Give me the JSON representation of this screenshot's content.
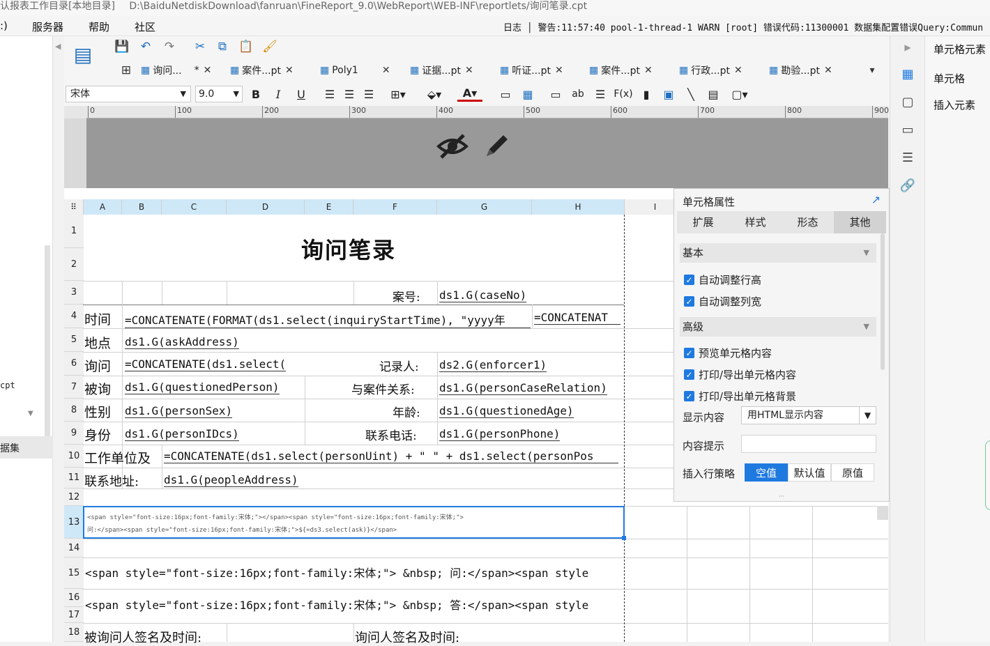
{
  "window": {
    "title_left": "认报表工作目录[本地目录]",
    "title_path": "D:\\BaiduNetdiskDownload\\fanruan\\FineReport_9.0\\WebReport\\WEB-INF\\reportlets/询问笔录.cpt"
  },
  "menubar": {
    "items": [
      ":)",
      "服务器",
      "帮助",
      "社区"
    ],
    "log": "日志 │ 警告:11:57:40 pool-1-thread-1 WARN [root] 错误代码:11300001 数据集配置错误Query:Commun"
  },
  "left_panel": {
    "item_cpt": "cpt",
    "item_dataset": "据集"
  },
  "tabs": [
    {
      "label": "询问...",
      "modified": "*",
      "close": "✕"
    },
    {
      "label": "案件...pt",
      "close": "✕"
    },
    {
      "label": "Poly1",
      "close": "✕"
    },
    {
      "label": "证据...pt",
      "close": "✕"
    },
    {
      "label": "听证...pt",
      "close": "✕"
    },
    {
      "label": "案件...pt",
      "close": "✕"
    },
    {
      "label": "行政...pt",
      "close": "✕"
    },
    {
      "label": "勘验...pt",
      "close": "✕"
    }
  ],
  "format_bar": {
    "font": "宋体",
    "size": "9.0",
    "bold": "B",
    "italic": "I",
    "underline": "U",
    "ab": "ab",
    "fx": "F(x)"
  },
  "ruler": {
    "marks": [
      "0",
      "100",
      "200",
      "300",
      "400",
      "500",
      "600",
      "700",
      "800",
      "900"
    ]
  },
  "sheet": {
    "columns": [
      "A",
      "B",
      "C",
      "D",
      "E",
      "F",
      "G",
      "H",
      "I"
    ],
    "rows": [
      "1",
      "2",
      "3",
      "4",
      "5",
      "6",
      "7",
      "8",
      "9",
      "10",
      "11",
      "12",
      "13",
      "14",
      "15",
      "16",
      "17",
      "18"
    ],
    "title": "询问笔录",
    "cells": {
      "case_no_label": "案号:",
      "case_no": "ds1.G(caseNo)",
      "time_label": "时间",
      "time_formula": "=CONCATENATE(FORMAT(ds1.select(inquiryStartTime), \"yyyy年",
      "time_formula2": "=CONCATENAT",
      "place_label": "地点",
      "place_value": "ds1.G(askAddress)",
      "ask_label": "询问",
      "ask_formula": "=CONCATENATE(ds1.select(",
      "recorder_label": "记录人:",
      "recorder_value": "ds2.G(enforcer1)",
      "questioned_label": "被询",
      "questioned_value": "ds1.G(questionedPerson)",
      "relation_label": "与案件关系:",
      "relation_value": "ds1.G(personCaseRelation)",
      "sex_label": "性别",
      "sex_value": "ds1.G(personSex)",
      "age_label": "年龄:",
      "age_value": "ds1.G(questionedAge)",
      "id_label": "身份",
      "id_value": "ds1.G(personIDcs)",
      "phone_label": "联系电话:",
      "phone_value": "ds1.G(personPhone)",
      "work_label": "工作单位及",
      "work_formula": "=CONCATENATE(ds1.select(personUint) + \"  \" + ds1.select(personPos",
      "address_label": "联系地址:",
      "address_value": "ds1.G(peopleAddress)",
      "row13_line1": "<span style=\"font-size:16px;font-family:宋体;\"></span><span style=\"font-size:16px;font-family:宋体;\">",
      "row13_line2": "问:</span><span style=\"font-size:16px;font-family:宋体;\">${=ds3.select(ask)}</span>",
      "row15": "<span style=\"font-size:16px;font-family:宋体;\"> &nbsp; 问:</span><span style",
      "row16": "<span style=\"font-size:16px;font-family:宋体;\"> &nbsp; 答:</span><span style",
      "row18_left": "被询问人签名及时间:",
      "row18_right": "询问人签名及时间:"
    }
  },
  "properties": {
    "title": "单元格属性",
    "tabs": [
      "扩展",
      "样式",
      "形态",
      "其他"
    ],
    "active_tab": "其他",
    "basic_section": "基本",
    "auto_row_height": "自动调整行高",
    "auto_col_width": "自动调整列宽",
    "advanced_section": "高级",
    "preview_content": "预览单元格内容",
    "print_content": "打印/导出单元格内容",
    "print_background": "打印/导出单元格背景",
    "display_label": "显示内容",
    "display_value": "用HTML显示内容",
    "hint_label": "内容提示",
    "hint_value": "",
    "insert_policy_label": "插入行策略",
    "insert_options": [
      "空值",
      "默认值",
      "原值"
    ],
    "insert_active": "空值"
  },
  "right_panel": {
    "title": "单元格元素",
    "items": [
      "单元格",
      "插入元素"
    ]
  },
  "colors": {
    "accent": "#1f7ae0",
    "selected_header": "#cfe8f8"
  }
}
